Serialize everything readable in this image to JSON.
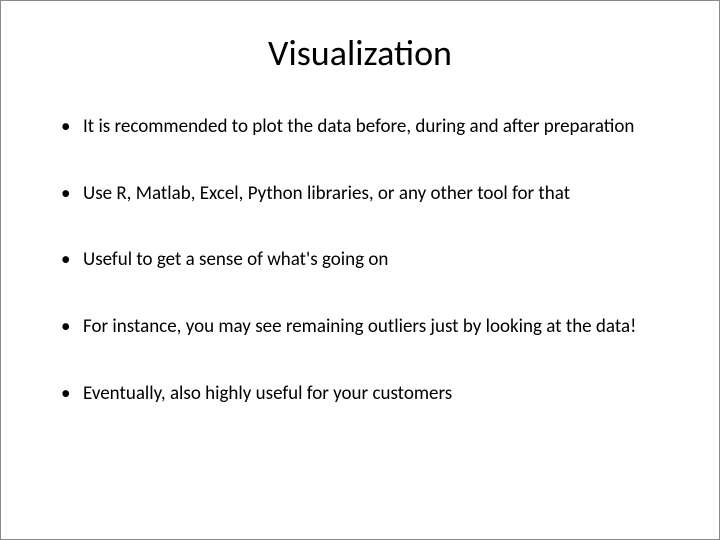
{
  "slide": {
    "title": "Visualization",
    "bullets": [
      "It is recommended to plot the data before, during and after preparation",
      "Use R, Matlab, Excel, Python libraries, or any other tool for that",
      "Useful to get a sense of what's going on",
      "For instance, you may see remaining outliers just by looking at the data!",
      "Eventually, also highly useful for your customers"
    ]
  }
}
